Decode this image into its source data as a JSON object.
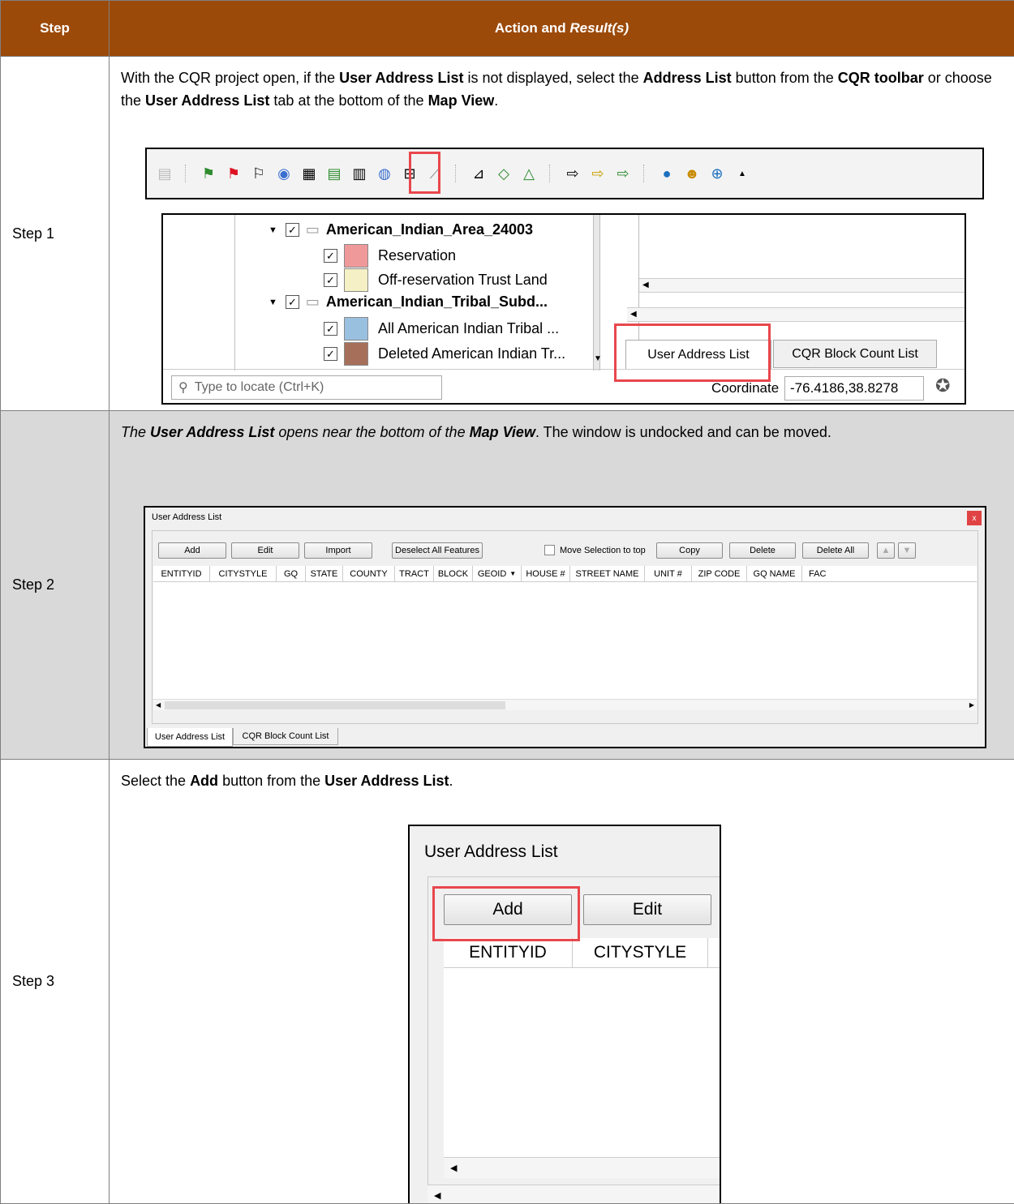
{
  "header": {
    "step": "Step",
    "action": "Action and ",
    "action_italic": "Result(s)"
  },
  "step1": {
    "label": "Step 1",
    "text": [
      "With the CQR project open, if the ",
      "User Address List",
      " is not displayed, select the ",
      "Address List",
      " button from the ",
      "CQR toolbar",
      " or choose the ",
      "User Address List",
      " tab at the bottom of the ",
      "Map View",
      "."
    ],
    "layers": [
      {
        "name": "American_Indian_Area_24003",
        "group": true
      },
      {
        "name": "Reservation",
        "color": "#f0999b"
      },
      {
        "name": "Off-reservation Trust Land",
        "color": "#f5f0c5"
      },
      {
        "name": "American_Indian_Tribal_Subd...",
        "group": true
      },
      {
        "name": "All American Indian Tribal ...",
        "color": "#9ac0df"
      },
      {
        "name": "Deleted American Indian Tr...",
        "color": "#a66f5a"
      }
    ],
    "tab_user": "User Address List",
    "tab_block": "CQR Block Count List",
    "locate_placeholder": "Type to locate (Ctrl+K)",
    "coord_label": "Coordinate",
    "coord_value": "-76.4186,38.8278"
  },
  "step2": {
    "label": "Step 2",
    "text_italic": "The ",
    "t1": "User Address List",
    "t2": " opens near the bottom of the ",
    "t3": "Map View",
    "t4": ". The window is undocked and can be moved.",
    "window_title": "User Address List",
    "close": "x",
    "buttons": [
      "Add",
      "Edit",
      "Import",
      "Deselect All Features",
      "Move Selection to top",
      "Copy",
      "Delete",
      "Delete All"
    ],
    "columns": [
      "ENTITYID",
      "CITYSTYLE",
      "GQ",
      "STATE",
      "COUNTY",
      "TRACT",
      "BLOCK",
      "GEOID",
      "HOUSE #",
      "STREET NAME",
      "UNIT #",
      "ZIP CODE",
      "GQ NAME",
      "FAC"
    ],
    "tab_user": "User Address List",
    "tab_block": "CQR Block Count List"
  },
  "step3": {
    "label": "Step 3",
    "text": [
      "Select the ",
      "Add",
      " button from the ",
      "User Address List",
      "."
    ],
    "window_title": "User Address List",
    "btn_add": "Add",
    "btn_edit": "Edit",
    "col1": "ENTITYID",
    "col2": "CITYSTYLE"
  }
}
